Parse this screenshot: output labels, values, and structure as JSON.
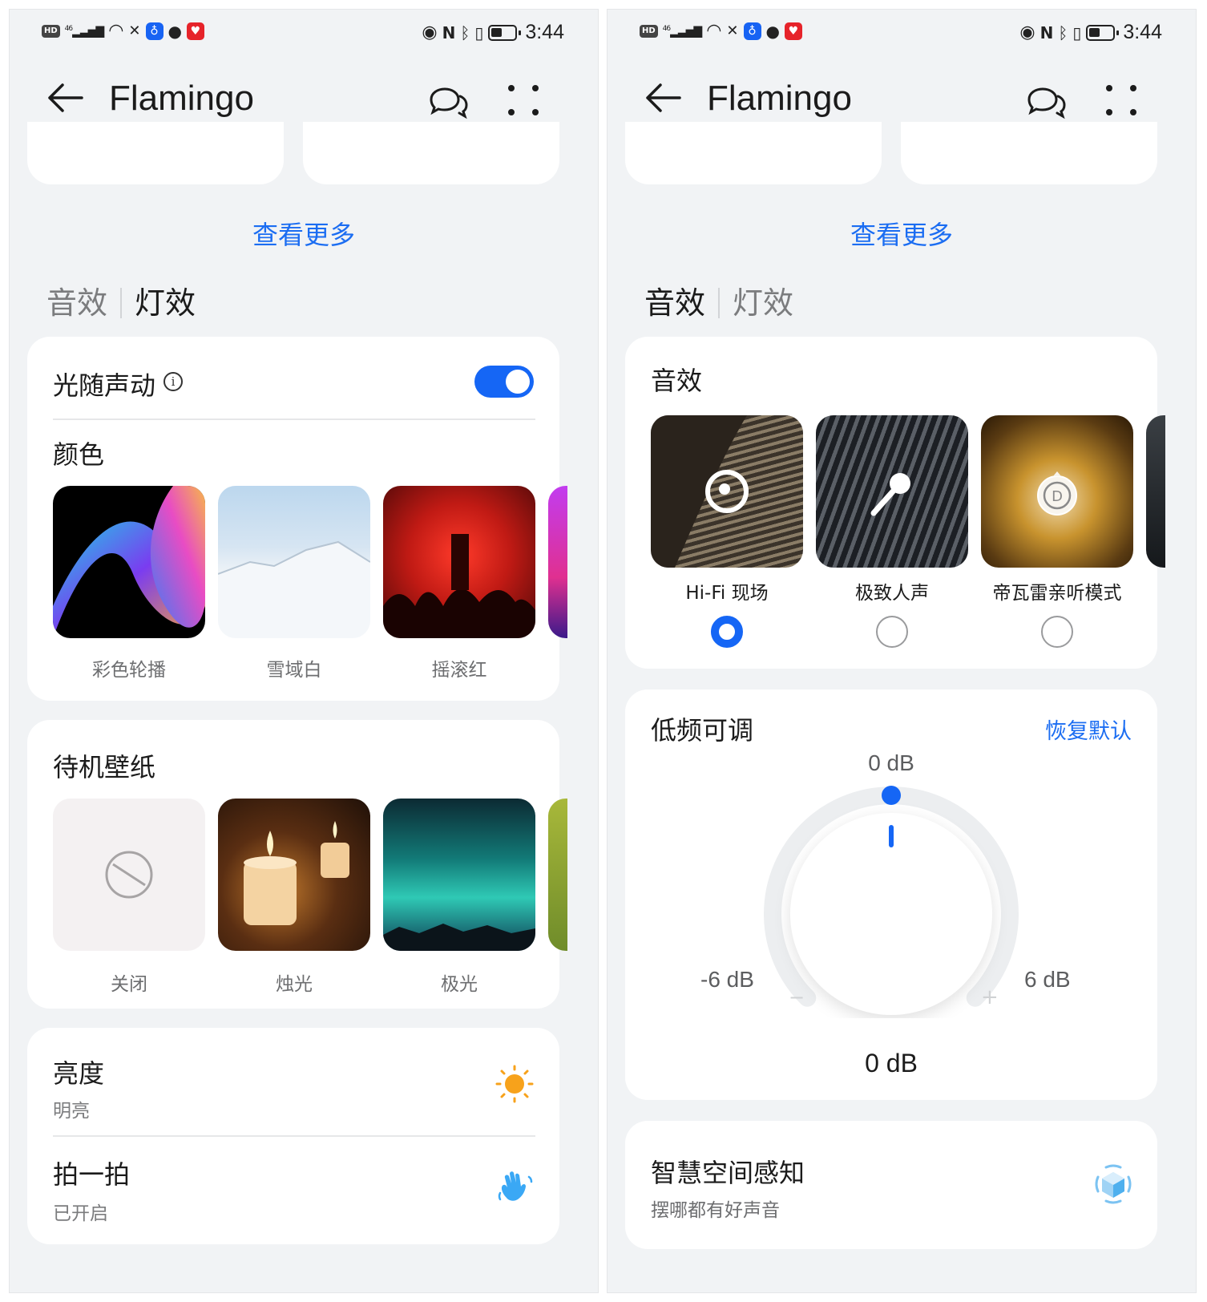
{
  "status_bar": {
    "hd": "HD",
    "network": "46",
    "time": "3:44"
  },
  "app_bar": {
    "title": "Flamingo"
  },
  "left_screen": {
    "see_more": "查看更多",
    "tabs": [
      {
        "label": "音效",
        "active": false
      },
      {
        "label": "灯效",
        "active": true
      }
    ],
    "light_follow_sound": {
      "label": "光随声动",
      "toggle_on": true
    },
    "color_section": {
      "title": "颜色",
      "items": [
        {
          "label": "彩色轮播"
        },
        {
          "label": "雪域白"
        },
        {
          "label": "摇滚红"
        }
      ]
    },
    "wallpaper_section": {
      "title": "待机壁纸",
      "items": [
        {
          "label": "关闭"
        },
        {
          "label": "烛光"
        },
        {
          "label": "极光"
        }
      ]
    },
    "brightness": {
      "title": "亮度",
      "value": "明亮"
    },
    "tap": {
      "title": "拍一拍",
      "value": "已开启"
    }
  },
  "right_screen": {
    "see_more": "查看更多",
    "tabs": [
      {
        "label": "音效",
        "active": true
      },
      {
        "label": "灯效",
        "active": false
      }
    ],
    "sound_effects": {
      "title": "音效",
      "items": [
        {
          "label": "Hi-Fi 现场",
          "selected": true
        },
        {
          "label": "极致人声",
          "selected": false
        },
        {
          "label": "帝瓦雷亲听模式",
          "selected": false
        }
      ]
    },
    "bass": {
      "title": "低频可调",
      "reset": "恢复默认",
      "top_label": "0 dB",
      "min_label": "-6 dB",
      "max_label": "6 dB",
      "current": "0 dB",
      "value_db": 0,
      "minus": "−",
      "plus": "+"
    },
    "spatial": {
      "title": "智慧空间感知",
      "subtitle": "摆哪都有好声音"
    }
  },
  "colors": {
    "accent": "#1566f5",
    "link": "#1b6df2",
    "background": "#f1f3f5",
    "sun": "#f7a21b"
  }
}
